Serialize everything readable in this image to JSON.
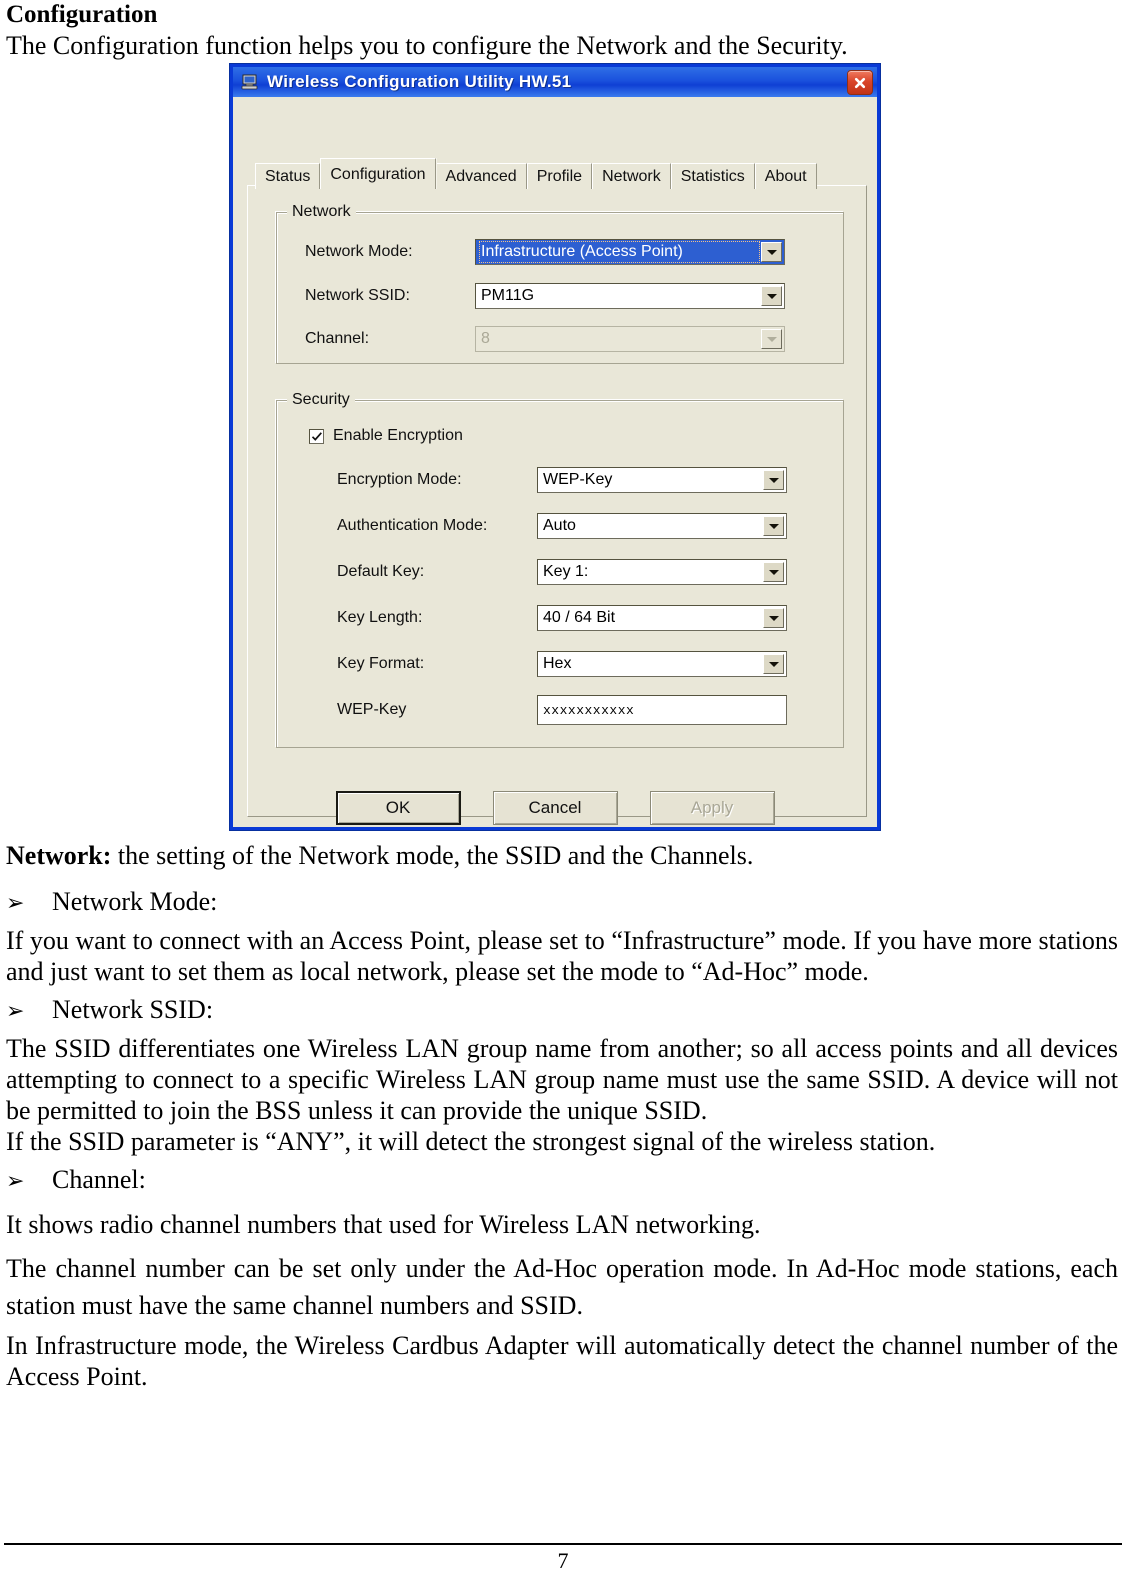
{
  "document": {
    "heading": "Configuration",
    "intro": "The Configuration function helps you to configure the Network and the Security.",
    "network_lead_bold": "Network:",
    "network_lead_rest": " the setting of the Network mode, the SSID and the Channels.",
    "bullet_glyph": "➢",
    "bullets": [
      {
        "label": "Network Mode:"
      },
      {
        "label": "Network SSID:"
      },
      {
        "label": "Channel:"
      }
    ],
    "paragraphs": {
      "network_mode": "If you want to connect with an Access Point, please set to “Infrastructure” mode. If you have more stations and just want to set them as local network, please set the mode to “Ad-Hoc” mode.",
      "ssid_1": "The SSID differentiates one Wireless LAN group name from another; so all access points and all devices attempting to connect to a specific Wireless LAN group name must use the same SSID. A device will not be permitted to join the BSS unless it can provide the unique SSID.",
      "ssid_2": "If the SSID parameter is “ANY”, it will detect the strongest signal of the wireless station.",
      "channel_1": "It shows radio channel numbers that used for Wireless LAN networking.",
      "channel_2": "The channel number can be set only under the Ad-Hoc operation mode. In Ad-Hoc mode stations, each station must have the same channel numbers and SSID.",
      "channel_3": "In Infrastructure mode, the Wireless Cardbus Adapter will automatically detect the channel number of the Access Point."
    },
    "page_number": "7"
  },
  "dialog": {
    "title": "Wireless Configuration Utility HW.51",
    "title_icon": "computer-icon",
    "close_icon": "close-icon",
    "tabs": [
      {
        "label": "Status",
        "active": false
      },
      {
        "label": "Configuration",
        "active": true
      },
      {
        "label": "Advanced",
        "active": false
      },
      {
        "label": "Profile",
        "active": false
      },
      {
        "label": "Network",
        "active": false
      },
      {
        "label": "Statistics",
        "active": false
      },
      {
        "label": "About",
        "active": false
      }
    ],
    "network_group": {
      "legend": "Network",
      "fields": [
        {
          "label": "Network Mode:",
          "value": "Infrastructure (Access Point)",
          "state": "selected"
        },
        {
          "label": "Network SSID:",
          "value": "PM11G",
          "state": "normal"
        },
        {
          "label": "Channel:",
          "value": "8",
          "state": "disabled"
        }
      ]
    },
    "security_group": {
      "legend": "Security",
      "checkbox": {
        "label": "Enable Encryption",
        "checked": true
      },
      "fields": [
        {
          "label": "Encryption Mode:",
          "value": "WEP-Key",
          "state": "normal"
        },
        {
          "label": "Authentication Mode:",
          "value": "Auto",
          "state": "normal"
        },
        {
          "label": "Default Key:",
          "value": "Key 1:",
          "state": "normal"
        },
        {
          "label": "Key Length:",
          "value": "40 / 64 Bit",
          "state": "normal"
        },
        {
          "label": "Key Format:",
          "value": "Hex",
          "state": "normal"
        }
      ],
      "wep_key": {
        "label": "WEP-Key",
        "value": "xxxxxxxxxxx"
      }
    },
    "buttons": [
      {
        "label": "OK",
        "state": "default"
      },
      {
        "label": "Cancel",
        "state": "normal"
      },
      {
        "label": "Apply",
        "state": "disabled"
      }
    ],
    "colors": {
      "titlebar_blue": "#1a51dd",
      "frame_blue": "#0a3ad6",
      "dialog_face": "#e9e7d8",
      "selection_blue": "#2d5fd1",
      "close_red": "#d9452a"
    }
  }
}
